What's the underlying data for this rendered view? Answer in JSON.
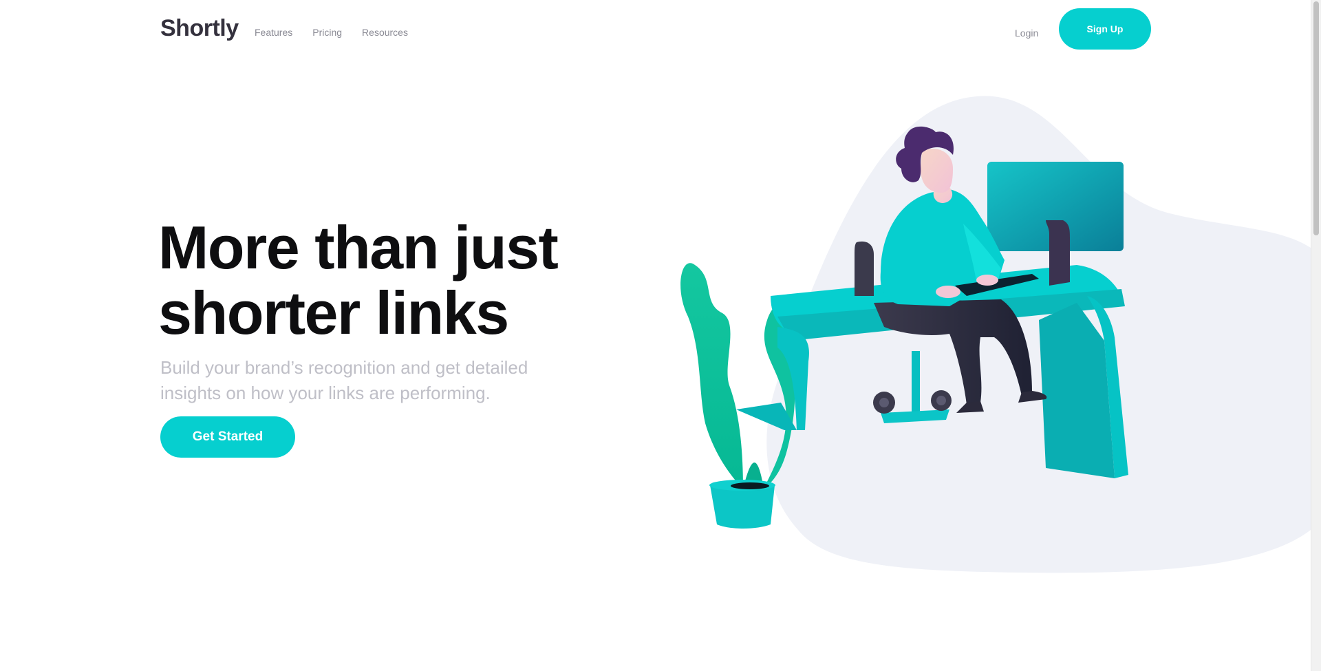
{
  "header": {
    "logo": "Shortly",
    "nav": [
      "Features",
      "Pricing",
      "Resources"
    ],
    "login_label": "Login",
    "signup_label": "Sign Up"
  },
  "hero": {
    "title_line1": "More than just",
    "title_line2": "shorter links",
    "subtitle": "Build your brand’s recognition and get detailed insights on how your links are performing.",
    "cta_label": "Get Started"
  },
  "colors": {
    "accent": "#06cfcf",
    "heading": "#0e0e10",
    "muted_text": "#bfbfc7",
    "nav_text": "#8a8a94",
    "logo": "#34313d",
    "illustration_blob": "#eff1f7",
    "hair": "#4b2b6e"
  },
  "icons": {
    "hero_illustration": "person-working-at-desk-illustration"
  }
}
